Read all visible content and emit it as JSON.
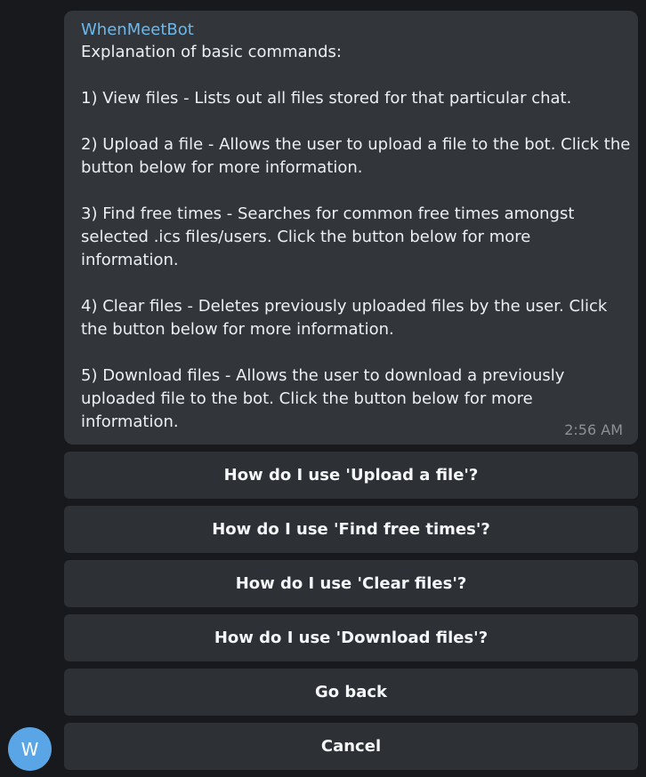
{
  "message": {
    "sender": "WhenMeetBot",
    "lines": [
      "Explanation of basic commands:",
      "",
      "1) View files - Lists out all files stored for that particular chat.",
      "",
      "2) Upload a file - Allows the user to upload a file to the bot. Click the",
      "button below for more information.",
      "",
      "3) Find free times - Searches for common free times amongst",
      "selected .ics files/users. Click the button below for more",
      "information.",
      "",
      "4) Clear files - Deletes previously uploaded files by the user. Click",
      "the button below for more information.",
      "",
      "5) Download files - Allows the user to download a previously",
      "uploaded file to the bot. Click the button below for more",
      "information."
    ],
    "time": "2:56 AM"
  },
  "keyboard": {
    "upload": "How do I use 'Upload a file'?",
    "find_free_times": "How do I use 'Find free times'?",
    "clear_files": "How do I use 'Clear files'?",
    "download_files": "How do I use 'Download files'?",
    "go_back": "Go back",
    "cancel": "Cancel"
  },
  "avatar": {
    "initial": "W"
  }
}
